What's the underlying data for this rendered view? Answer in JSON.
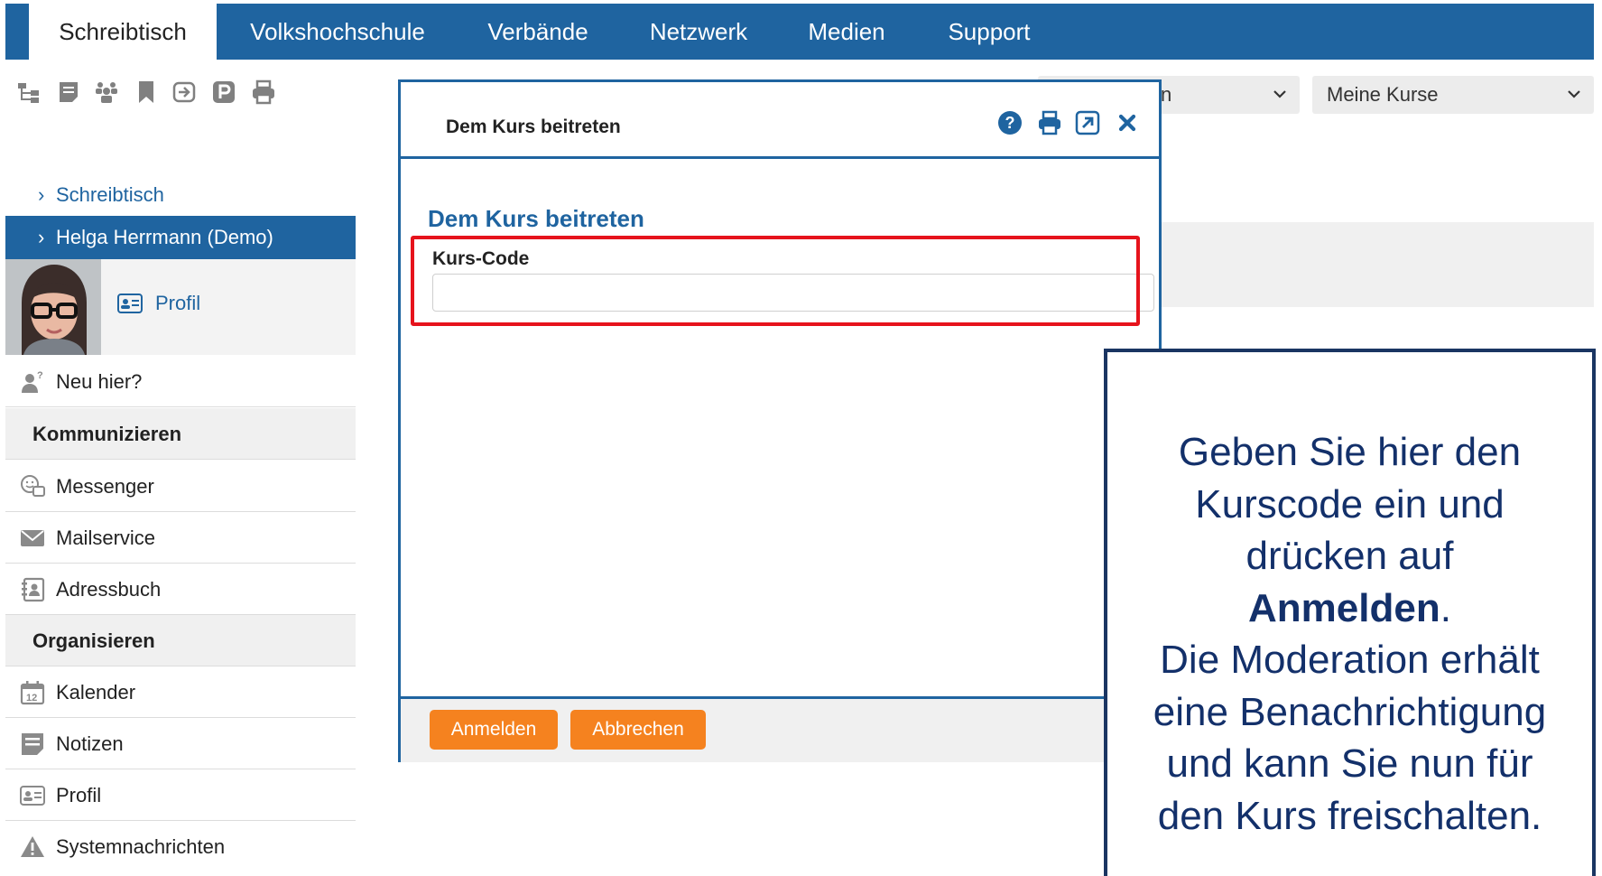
{
  "nav": {
    "tabs": [
      {
        "label": "Schreibtisch",
        "active": true
      },
      {
        "label": "Volkshochschule"
      },
      {
        "label": "Verbände"
      },
      {
        "label": "Netzwerk"
      },
      {
        "label": "Medien"
      },
      {
        "label": "Support"
      }
    ]
  },
  "toolbar": {
    "icons": [
      "sitemap-icon",
      "notes-icon",
      "group-icon",
      "bookmark-icon",
      "login-icon",
      "parking-icon",
      "print-icon"
    ]
  },
  "filters": {
    "select1_value": "n",
    "select2_value": "Meine Kurse"
  },
  "sidebar": {
    "crumb1": "Schreibtisch",
    "crumb2": "Helga Herrmann (Demo)",
    "profile_link": "Profil",
    "new_here": "Neu hier?",
    "section_communicate": "Kommunizieren",
    "messenger": "Messenger",
    "mailservice": "Mailservice",
    "addressbook": "Adressbuch",
    "section_organize": "Organisieren",
    "calendar": "Kalender",
    "notes": "Notizen",
    "profile": "Profil",
    "system_messages": "Systemnachrichten"
  },
  "modal": {
    "title": "Dem Kurs beitreten",
    "section_title": "Dem Kurs beitreten",
    "field_label": "Kurs-Code",
    "field_value": "",
    "submit_label": "Anmelden",
    "cancel_label": "Abbrechen"
  },
  "callout": {
    "line1": "Geben Sie hier den",
    "line2": "Kurscode ein und",
    "line3": "drücken auf",
    "line4_bold": "Anmelden",
    "line4_rest": ".",
    "line5": "Die Moderation erhält",
    "line6": "eine Benachrichtigung",
    "line7": "und kann Sie nun für",
    "line8": "den Kurs freischalten."
  },
  "colors": {
    "brand_blue": "#1f64a0",
    "button_orange": "#f5821f",
    "highlight_red": "#e6131c",
    "callout_navy": "#13306a"
  }
}
